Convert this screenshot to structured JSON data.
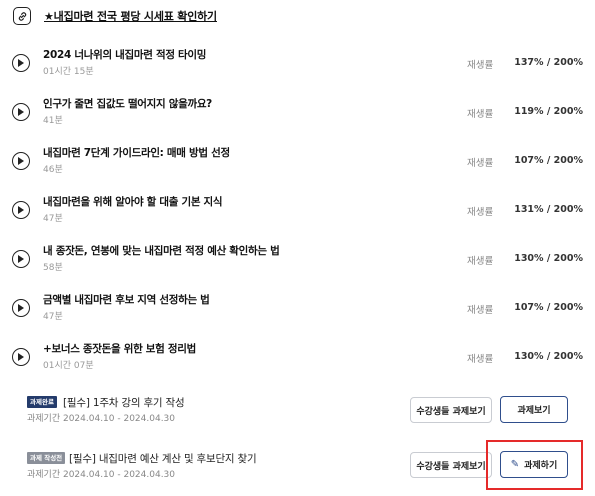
{
  "top_link": {
    "text": "★내집마련 전국 평당 시세표 확인하기",
    "icon": "link-icon"
  },
  "play_label": "재생률",
  "lectures": [
    {
      "title": "2024 너나위의 내집마련 적정 타이밍",
      "duration": "01시간 15분",
      "rate": "137% / 200%"
    },
    {
      "title": "인구가 줄면 집값도 떨어지지 않을까요?",
      "duration": "41분",
      "rate": "119% / 200%"
    },
    {
      "title": "내집마련 7단계 가이드라인: 매매 방법 선정",
      "duration": "46분",
      "rate": "107% / 200%"
    },
    {
      "title": "내집마련을 위해 알아야 할 대출 기본 지식",
      "duration": "47분",
      "rate": "131% / 200%"
    },
    {
      "title": "내 종잣돈, 연봉에 맞는 내집마련 적정 예산 확인하는 법",
      "duration": "58분",
      "rate": "130% / 200%"
    },
    {
      "title": "금액별 내집마련 후보 지역 선정하는 법",
      "duration": "47분",
      "rate": "107% / 200%"
    },
    {
      "title": "+보너스 종잣돈을 위한 보험 정리법",
      "duration": "01시간 07분",
      "rate": "130% / 200%"
    }
  ],
  "assignments": [
    {
      "badge": "과제완료",
      "title": "[필수] 1주차 강의 후기 작성",
      "period": "과제기간 2024.04.10 - 2024.04.30",
      "peer_button": "수강생들 과제보기",
      "main_button": "과제보기"
    },
    {
      "badge": "과제 작성전",
      "title": "[필수] 내집마련 예산 계산 및 후보단지 찾기",
      "period": "과제기간 2024.04.10 - 2024.04.30",
      "peer_button": "수강생들 과제보기",
      "main_button": "과제하기"
    }
  ],
  "colors": {
    "highlight": "#e52a2a",
    "badge_done": "#243b6b",
    "badge_writing": "#8a8f99"
  }
}
